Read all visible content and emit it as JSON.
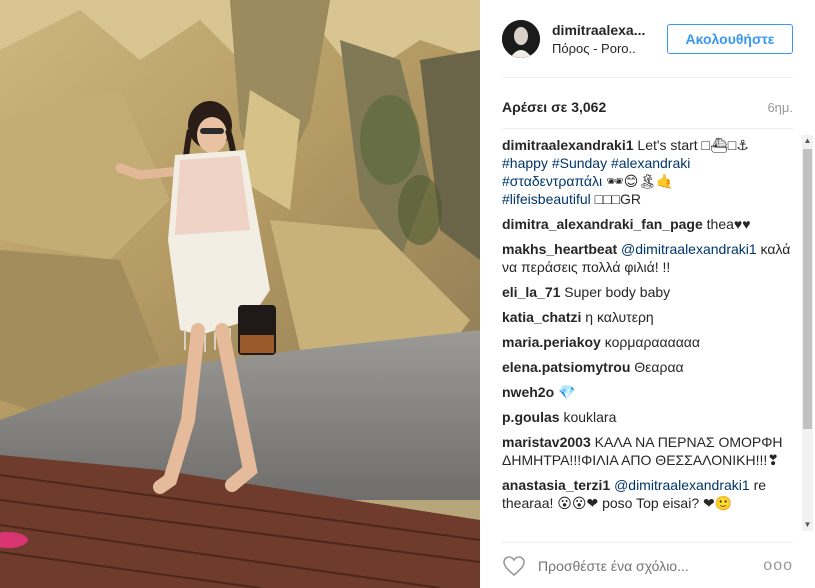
{
  "post": {
    "username": "dimitraalexa...",
    "location": "Πόρος - Poro..",
    "follow_label": "Ακολουθήστε",
    "likes": "Αρέσει σε 3,062",
    "time": "6ημ."
  },
  "caption": {
    "user": "dimitraalexandraki1",
    "text1": " Let's start □⛴□⚓",
    "hashtags1": "#happy #Sunday #alexandraki",
    "hashtags2": "#σταδεντραπάλι",
    "emoji2": " 🕶😊🏝🤙",
    "hashtags3": "#lifeisbeautiful",
    "text3": " □□□GR"
  },
  "comments": [
    {
      "user": "dimitra_alexandraki_fan_page",
      "text": " thea♥♥"
    },
    {
      "user": "makhs_heartbeat",
      "mention": " @dimitraalexandraki1",
      "text": " καλά να περάσεις πολλά φιλιά! !!"
    },
    {
      "user": "eli_la_71",
      "text": " Super body baby"
    },
    {
      "user": "katia_chatzi",
      "text": " η καλυτερη"
    },
    {
      "user": "maria.periakoy",
      "text": " κορμαραααααα"
    },
    {
      "user": "elena.patsiomytrou",
      "text": " Θεαραα"
    },
    {
      "user": "nweh2o",
      "text": " 💎"
    },
    {
      "user": "p.goulas",
      "text": " kouklara"
    },
    {
      "user": "maristav2003",
      "text": " ΚΑΛΑ ΝΑ ΠΕΡΝΑΣ ΟΜΟΡΦΗ ΔΗΜΗΤΡΑ!!!ΦΙΛΙΑ ΑΠΟ ΘΕΣΣΑΛΟΝΙΚΗ!!!❣"
    },
    {
      "user": "anastasia_terzi1",
      "mention": " @dimitraalexandraki1",
      "text": " re thearaa! 😮😮❤ poso Top eisai? ❤🙂"
    }
  ],
  "footer": {
    "placeholder": "Προσθέστε ένα σχόλιο...",
    "more": "ooo"
  },
  "colors": {
    "accent": "#3897f0",
    "link": "#003569",
    "muted": "#999999"
  },
  "icons": [
    "heart-icon",
    "more-options-icon",
    "scroll-up-arrow-icon",
    "scroll-down-arrow-icon"
  ]
}
